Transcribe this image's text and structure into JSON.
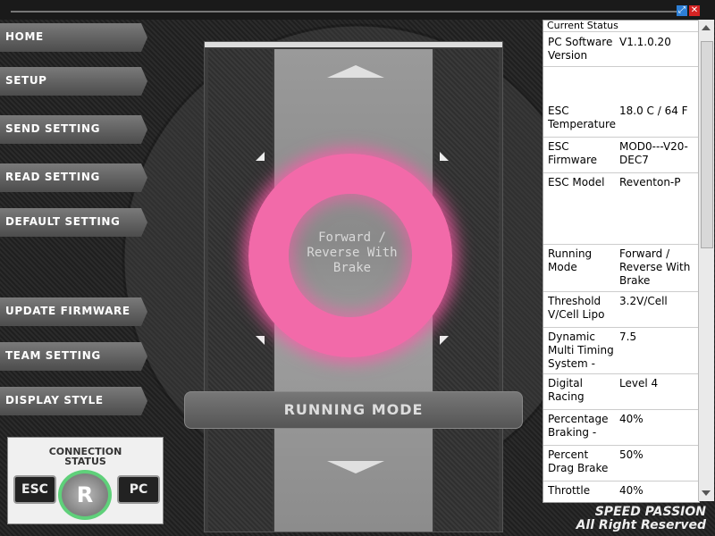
{
  "window": {
    "max_icon": "maximize-icon",
    "close_icon": "close-icon"
  },
  "nav": {
    "home": "HOME",
    "setup": "SETUP",
    "send_setting": "SEND SETTING",
    "read_setting": "READ SETTING",
    "default_setting": "DEFAULT SETTING",
    "update_firmware": "UPDATE FIRMWARE",
    "team_setting": "TEAM SETTING",
    "display_style": "DISPLAY STYLE"
  },
  "main": {
    "mode_value": "Forward /\nReverse With\nBrake",
    "run_label": "RUNNING MODE"
  },
  "connection": {
    "title_line1": "CONNECTION",
    "title_line2": "STATUS",
    "esc": "ESC",
    "pc": "PC",
    "logo": "R"
  },
  "status": {
    "header": "Current Status",
    "rows": [
      {
        "k": "PC Software Version",
        "v": "V1.1.0.20"
      },
      {
        "k": "ESC Temperature",
        "v": "18.0 C / 64 F"
      },
      {
        "k": "ESC Firmware",
        "v": "MOD0---V20-DEC7"
      },
      {
        "k": "ESC Model",
        "v": "Reventon-P"
      },
      {
        "k": "Running Mode",
        "v": "Forward / Reverse With Brake"
      },
      {
        "k": "Threshold V/Cell Lipo",
        "v": "3.2V/Cell"
      },
      {
        "k": "Dynamic Multi Timing System -",
        "v": "7.5"
      },
      {
        "k": "Digital Racing",
        "v": "Level 4"
      },
      {
        "k": "Percentage Braking -",
        "v": "40%"
      },
      {
        "k": "Percent Drag Brake",
        "v": "50%"
      },
      {
        "k": "Throttle",
        "v": "40%"
      }
    ]
  },
  "footer": {
    "line1": "SPEED PASSION",
    "line2": "All Right Reserved"
  }
}
